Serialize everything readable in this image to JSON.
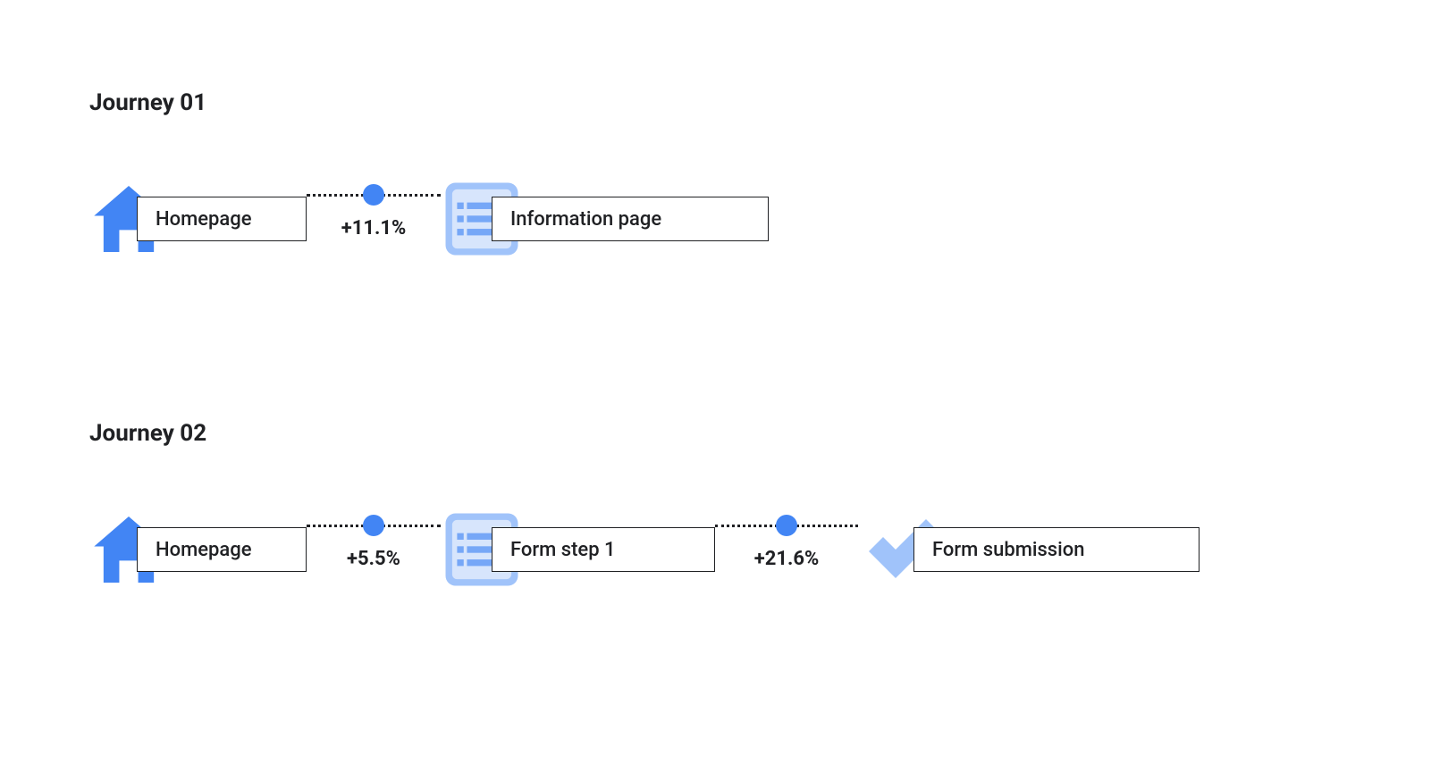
{
  "colors": {
    "primary": "#4285f4",
    "primary_light": "#a0c3fa",
    "text": "#202124"
  },
  "journeys": [
    {
      "title": "Journey 01",
      "steps": [
        {
          "icon": "home",
          "label": "Homepage"
        },
        {
          "icon": "page",
          "label": "Information page"
        }
      ],
      "transitions": [
        {
          "delta": "+11.1%"
        }
      ]
    },
    {
      "title": "Journey 02",
      "steps": [
        {
          "icon": "home",
          "label": "Homepage"
        },
        {
          "icon": "page",
          "label": "Form step 1"
        },
        {
          "icon": "check",
          "label": "Form submission"
        }
      ],
      "transitions": [
        {
          "delta": "+5.5%"
        },
        {
          "delta": "+21.6%"
        }
      ]
    }
  ]
}
